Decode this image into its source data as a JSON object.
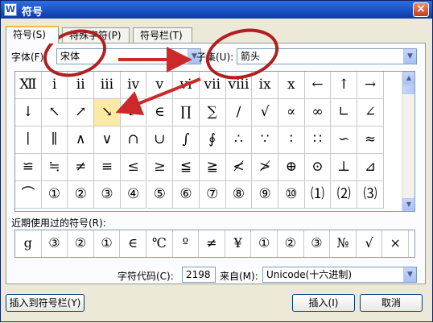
{
  "window": {
    "title": "符号",
    "app_icon": "W",
    "close_glyph": "×"
  },
  "tabs": [
    {
      "label": "符号(S)",
      "active": true
    },
    {
      "label": "特殊字符(P)",
      "active": false
    },
    {
      "label": "符号栏(T)",
      "active": false
    }
  ],
  "font": {
    "label": "字体(F):",
    "value": "宋体"
  },
  "subset": {
    "label": "子集(U):",
    "value": "箭头"
  },
  "symbols": [
    [
      "Ⅻ",
      "ⅰ",
      "ⅱ",
      "ⅲ",
      "ⅳ",
      "ⅴ",
      "ⅵ",
      "ⅶ",
      "ⅷ",
      "ⅸ",
      "ⅹ",
      "←",
      "↑",
      "→"
    ],
    [
      "↓",
      "↖",
      "↗",
      "↘",
      "↙",
      "∈",
      "∏",
      "∑",
      "∕",
      "√",
      "∝",
      "∞",
      "∟",
      "∠"
    ],
    [
      "∣",
      "∥",
      "∧",
      "∨",
      "∩",
      "∪",
      "∫",
      "∮",
      "∴",
      "∵",
      "∶",
      "∷",
      "∽",
      "≈"
    ],
    [
      "≌",
      "≒",
      "≠",
      "≡",
      "≤",
      "≥",
      "≦",
      "≧",
      "≮",
      "≯",
      "⊕",
      "⊙",
      "⊥",
      "⊿"
    ],
    [
      "⌒",
      "①",
      "②",
      "③",
      "④",
      "⑤",
      "⑥",
      "⑦",
      "⑧",
      "⑨",
      "⑩",
      "⑴",
      "⑵",
      "⑶"
    ]
  ],
  "selected_symbol": {
    "row": 1,
    "col": 3
  },
  "recent": {
    "label": "近期使用过的符号(R):",
    "items": [
      "g",
      "③",
      "②",
      "①",
      "∈",
      "℃",
      "º",
      "≠",
      "¥",
      "①",
      "②",
      "③",
      "№",
      "√",
      "×"
    ]
  },
  "char_code": {
    "label": "字符代码(C):",
    "value": "2198"
  },
  "from": {
    "label": "来自(M):",
    "value": "Unicode(十六进制)"
  },
  "buttons": {
    "insert_to_bar": "插入到符号栏(Y)",
    "insert": "插入(I)",
    "cancel": "取消"
  },
  "icons": {
    "dropdown": "chevron-down-icon",
    "scroll_up": "arrow-up-icon",
    "scroll_down": "arrow-down-icon"
  },
  "colors": {
    "titlebar": "#1a4fc0",
    "selection": "#fde9a6",
    "annotation": "#cc2a2a"
  }
}
